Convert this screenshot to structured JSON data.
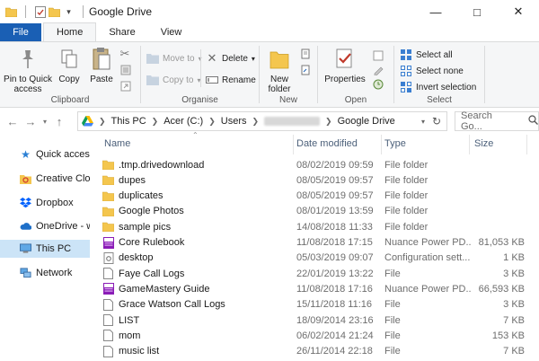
{
  "window": {
    "title": "Google Drive"
  },
  "ribbon_tabs": [
    "File",
    "Home",
    "Share",
    "View"
  ],
  "ribbon": {
    "clipboard": {
      "label": "Clipboard",
      "pin": "Pin to Quick access",
      "copy": "Copy",
      "paste": "Paste"
    },
    "organise": {
      "label": "Organise",
      "move_to": "Move to",
      "copy_to": "Copy to",
      "delete": "Delete",
      "rename": "Rename"
    },
    "new": {
      "label": "New",
      "new_folder": "New folder"
    },
    "open": {
      "label": "Open",
      "properties": "Properties"
    },
    "select": {
      "label": "Select",
      "select_all": "Select all",
      "select_none": "Select none",
      "invert_selection": "Invert selection"
    }
  },
  "address": {
    "crumbs": [
      "This PC",
      "Acer (C:)",
      "Users",
      "Google Drive"
    ],
    "search_placeholder": "Search Go..."
  },
  "nav_pane": {
    "items": [
      "Quick access",
      "Creative Cloud",
      "Dropbox",
      "OneDrive - wi",
      "This PC",
      "Network"
    ]
  },
  "columns": {
    "name": "Name",
    "date": "Date modified",
    "type": "Type",
    "size": "Size"
  },
  "files": [
    {
      "name": ".tmp.drivedownload",
      "date": "08/02/2019 09:59",
      "type": "File folder",
      "size": "",
      "icon": "folder-icon"
    },
    {
      "name": "dupes",
      "date": "08/05/2019 09:57",
      "type": "File folder",
      "size": "",
      "icon": "folder-icon"
    },
    {
      "name": "duplicates",
      "date": "08/05/2019 09:57",
      "type": "File folder",
      "size": "",
      "icon": "folder-icon"
    },
    {
      "name": "Google Photos",
      "date": "08/01/2019 13:59",
      "type": "File folder",
      "size": "",
      "icon": "folder-icon"
    },
    {
      "name": "sample pics",
      "date": "14/08/2018 11:33",
      "type": "File folder",
      "size": "",
      "icon": "folder-icon"
    },
    {
      "name": "Core Rulebook",
      "date": "11/08/2018 17:15",
      "type": "Nuance Power PD...",
      "size": "81,053 KB",
      "icon": "pdf-icon"
    },
    {
      "name": "desktop",
      "date": "05/03/2019 09:07",
      "type": "Configuration sett...",
      "size": "1 KB",
      "icon": "config-file-icon"
    },
    {
      "name": "Faye Call Logs",
      "date": "22/01/2019 13:22",
      "type": "File",
      "size": "3 KB",
      "icon": "file-icon"
    },
    {
      "name": "GameMastery Guide",
      "date": "11/08/2018 17:16",
      "type": "Nuance Power PD...",
      "size": "66,593 KB",
      "icon": "pdf-icon"
    },
    {
      "name": "Grace Watson Call Logs",
      "date": "15/11/2018 11:16",
      "type": "File",
      "size": "3 KB",
      "icon": "file-icon"
    },
    {
      "name": "LIST",
      "date": "18/09/2014 23:16",
      "type": "File",
      "size": "7 KB",
      "icon": "file-icon"
    },
    {
      "name": "mom",
      "date": "06/02/2014 21:24",
      "type": "File",
      "size": "153 KB",
      "icon": "file-icon"
    },
    {
      "name": "music list",
      "date": "26/11/2014 22:18",
      "type": "File",
      "size": "7 KB",
      "icon": "file-icon"
    }
  ],
  "colors": {
    "file_tab": "#1a5fb4",
    "selection": "#cce4f7",
    "folder": "#f4c64e",
    "pdf": "#8a1cb6"
  }
}
